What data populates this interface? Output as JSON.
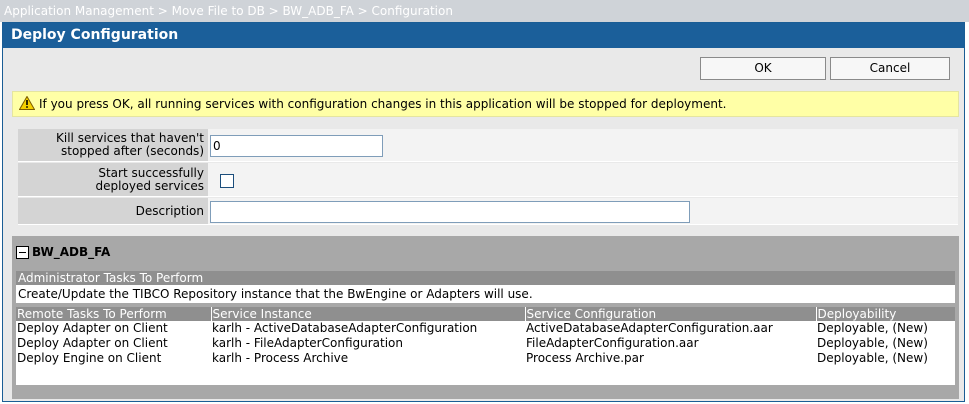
{
  "breadcrumb": "Application Management > Move File to DB > BW_ADB_FA > Configuration",
  "panel": {
    "title": "Deploy Configuration",
    "ok_label": "OK",
    "cancel_label": "Cancel"
  },
  "warning": {
    "icon": "warning-triangle-icon",
    "text": "If you press OK, all running services with configuration changes in this application will be stopped for deployment."
  },
  "form": {
    "kill_label_line1": "Kill services that haven't",
    "kill_label_line2": "stopped after (seconds)",
    "kill_value": "0",
    "start_label_line1": "Start successfully",
    "start_label_line2": "deployed services",
    "start_checked": false,
    "description_label": "Description",
    "description_value": ""
  },
  "section": {
    "title": "BW_ADB_FA",
    "admin_header": "Administrator Tasks To Perform",
    "admin_task": "Create/Update the TIBCO Repository instance that the BwEngine or Adapters will use.",
    "remote_headers": [
      "Remote Tasks To Perform",
      "Service Instance",
      "Service Configuration",
      "Deployability"
    ],
    "remote_rows": [
      [
        "Deploy Adapter on Client",
        "karlh - ActiveDatabaseAdapterConfiguration",
        "ActiveDatabaseAdapterConfiguration.aar",
        "Deployable, (New)"
      ],
      [
        "Deploy Adapter on Client",
        "karlh - FileAdapterConfiguration",
        "FileAdapterConfiguration.aar",
        "Deployable, (New)"
      ],
      [
        "Deploy Engine on Client",
        "karlh - Process Archive",
        "Process Archive.par",
        "Deployable, (New)"
      ]
    ]
  }
}
